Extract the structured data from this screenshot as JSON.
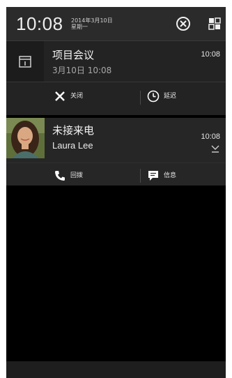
{
  "header": {
    "time": "10:08",
    "date": "2014年3月10日",
    "weekday": "星期一"
  },
  "notifications": [
    {
      "type": "calendar",
      "title": "项目会议",
      "subtitle": "3月10日 10:08",
      "time": "10:08",
      "icon": "calendar-icon",
      "actions": [
        {
          "label": "关闭",
          "icon": "close-icon"
        },
        {
          "label": "延迟",
          "icon": "clock-icon"
        }
      ]
    },
    {
      "type": "missed-call",
      "title": "未接来电",
      "subtitle": "Laura Lee",
      "time": "10:08",
      "icon": "missed-call-icon",
      "actions": [
        {
          "label": "回拨",
          "icon": "phone-icon"
        },
        {
          "label": "信息",
          "icon": "message-icon"
        }
      ]
    }
  ],
  "colors": {
    "background": "#000000",
    "header": "#2b2b2b",
    "card": "#232323",
    "text": "#f2f2f2"
  }
}
